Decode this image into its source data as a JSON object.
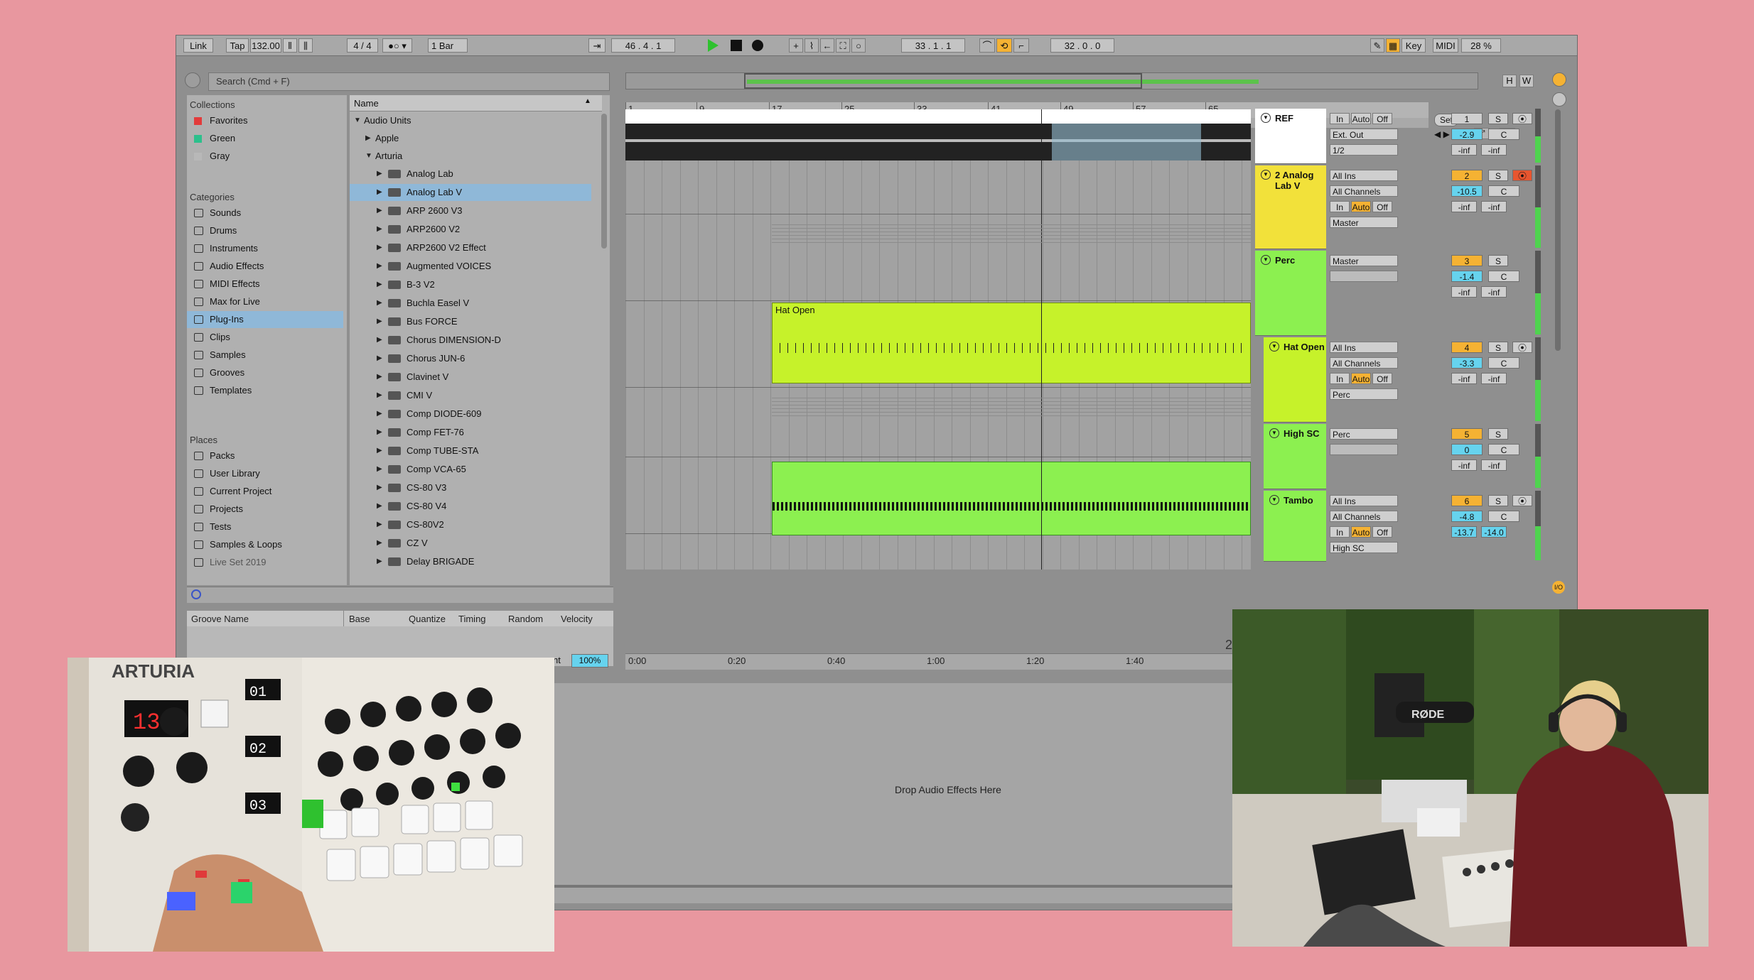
{
  "toolbar": {
    "link": "Link",
    "tap": "Tap",
    "tempo": "132.00",
    "signature": "4 / 4",
    "quantize": "1 Bar",
    "position": "46 .  4 .  1",
    "loop_start": "33 .  1 .  1",
    "loop_length": "32 .  0 .  0",
    "key": "Key",
    "midi": "MIDI",
    "cpu": "28 %"
  },
  "browser": {
    "search_placeholder": "Search (Cmd + F)",
    "collections_heading": "Collections",
    "collections": [
      {
        "label": "Favorites",
        "color": "#e23b3b"
      },
      {
        "label": "Green",
        "color": "#2cc08c"
      },
      {
        "label": "Gray",
        "color": "#b8b8b8"
      }
    ],
    "categories_heading": "Categories",
    "categories": [
      "Sounds",
      "Drums",
      "Instruments",
      "Audio Effects",
      "MIDI Effects",
      "Max for Live",
      "Plug-Ins",
      "Clips",
      "Samples",
      "Grooves",
      "Templates"
    ],
    "selected_category": "Plug-Ins",
    "places_heading": "Places",
    "places": [
      "Packs",
      "User Library",
      "Current Project",
      "Projects",
      "Tests",
      "Samples & Loops",
      "Live Set 2019"
    ],
    "name_column": "Name",
    "tree": {
      "root": "Audio Units",
      "folders": [
        "Apple",
        "Arturia"
      ],
      "plugins": [
        "Analog Lab",
        "Analog Lab V",
        "ARP 2600 V3",
        "ARP2600 V2",
        "ARP2600 V2 Effect",
        "Augmented VOICES",
        "B-3 V2",
        "Buchla Easel V",
        "Bus FORCE",
        "Chorus DIMENSION-D",
        "Chorus JUN-6",
        "Clavinet V",
        "CMI V",
        "Comp DIODE-609",
        "Comp FET-76",
        "Comp TUBE-STA",
        "Comp VCA-65",
        "CS-80 V3",
        "CS-80 V4",
        "CS-80V2",
        "CZ V",
        "Delay BRIGADE"
      ],
      "selected_plugin": "Analog Lab V"
    }
  },
  "groove_pool": {
    "columns": [
      "Groove Name",
      "Base",
      "Quantize",
      "Timing",
      "Random",
      "Velocity"
    ],
    "amount_label": "nt",
    "amount_value": "100%"
  },
  "arrangement": {
    "bars": [
      "1",
      "9",
      "17",
      "25",
      "33",
      "41",
      "49",
      "57",
      "65"
    ],
    "times": [
      "0:00",
      "0:20",
      "0:40",
      "1:00",
      "1:20",
      "1:40"
    ],
    "set_button": "Set",
    "drop_zone_text": "Drop Audio Effects Here",
    "corner_digit": "2",
    "clips": [
      {
        "name": "Hat Open",
        "color": "#c6f22a"
      },
      {
        "name": "",
        "color": "#8cf050"
      }
    ]
  },
  "tracks": [
    {
      "name": "REF",
      "number": "1",
      "volume": "-2.9",
      "pan": "C",
      "send_a": "-inf",
      "send_b": "-inf",
      "io_top": "Ext. Out",
      "io_mid": "1/2",
      "color": "#ffffff",
      "armed": false
    },
    {
      "name": "2 Analog Lab V",
      "number": "2",
      "volume": "-10.5",
      "pan": "C",
      "send_a": "-inf",
      "send_b": "-inf",
      "io_top": "All Ins",
      "io_mid": "All Channels",
      "io_bottom": "Master",
      "color": "#f2e13a",
      "armed": true
    },
    {
      "name": "Perc",
      "number": "3",
      "volume": "-1.4",
      "pan": "C",
      "send_a": "-inf",
      "send_b": "-inf",
      "io_top": "Master",
      "color": "#8cf050",
      "armed": false
    },
    {
      "name": "Hat Open",
      "number": "4",
      "volume": "-3.3",
      "pan": "C",
      "send_a": "-inf",
      "send_b": "-inf",
      "io_top": "All Ins",
      "io_mid": "All Channels",
      "io_bottom": "Perc",
      "color": "#c6f22a",
      "armed": false
    },
    {
      "name": "High SC",
      "number": "5",
      "volume": "0",
      "pan": "C",
      "send_a": "-inf",
      "send_b": "-inf",
      "io_top": "Perc",
      "color": "#8cf050",
      "armed": false
    },
    {
      "name": "Tambo",
      "number": "6",
      "volume": "-4.8",
      "pan": "C",
      "send_a": "-13.7",
      "send_b": "-14.0",
      "io_top": "All Ins",
      "io_mid": "All Channels",
      "io_bottom": "High SC",
      "color": "#8cf050",
      "armed": false
    }
  ],
  "monitor_labels": {
    "in": "In",
    "auto": "Auto",
    "off": "Off",
    "solo": "S"
  },
  "video_left": {
    "brand_text": "ARTURIA",
    "display_a": "131",
    "display_b": "01",
    "display_c": "02",
    "display_d": "03"
  },
  "video_right": {
    "mic_brand": "RØDE"
  },
  "colors": {
    "background": "#e8979f",
    "accent_orange": "#f5b233",
    "accent_blue": "#66d3ee",
    "play_green": "#2fc12f"
  }
}
